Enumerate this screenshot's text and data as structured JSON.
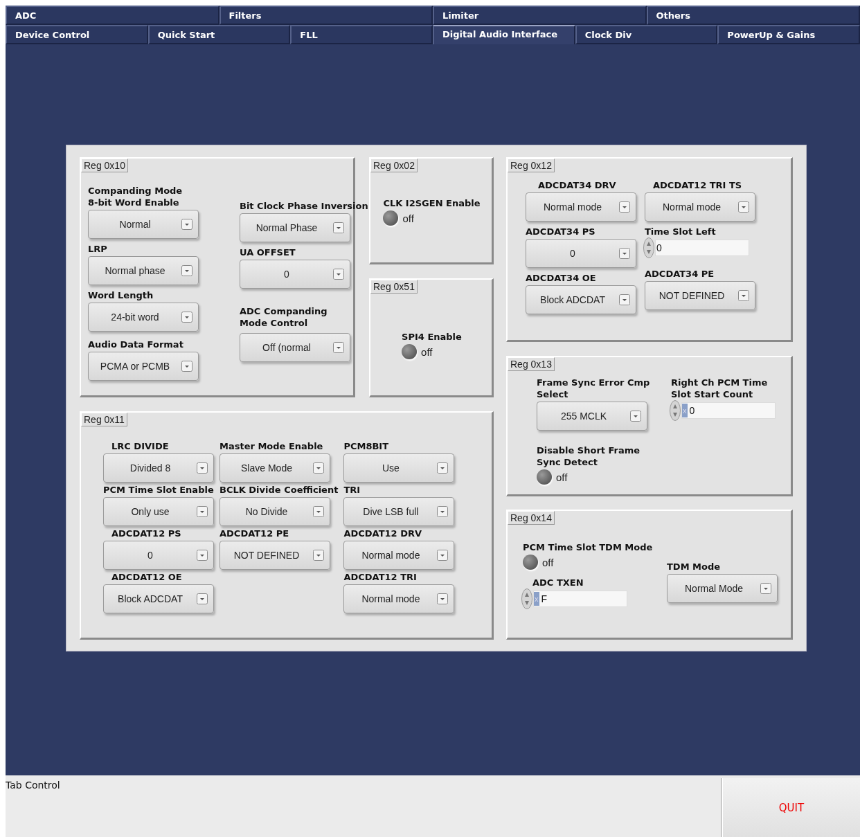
{
  "tab_rows": [
    [
      {
        "label": "ADC",
        "selected": false
      },
      {
        "label": "Filters",
        "selected": false
      },
      {
        "label": "Limiter",
        "selected": false
      },
      {
        "label": "Others",
        "selected": false
      }
    ],
    [
      {
        "label": "Device Control",
        "selected": false
      },
      {
        "label": "Quick Start",
        "selected": false
      },
      {
        "label": "FLL",
        "selected": false
      },
      {
        "label": "Digital Audio Interface",
        "selected": true
      },
      {
        "label": "Clock Div",
        "selected": false
      },
      {
        "label": "PowerUp & Gains",
        "selected": false
      }
    ]
  ],
  "panels": [
    {
      "title": "Reg 0x10",
      "columns": [
        [
          {
            "kind": "dropdown",
            "label": "Companding Mode 8-bit Word Enable",
            "value": "Normal"
          },
          {
            "kind": "dropdown",
            "label": "LRP",
            "value": "Normal phase"
          },
          {
            "kind": "dropdown",
            "label": "Word Length",
            "value": "24-bit word"
          },
          {
            "kind": "dropdown",
            "label": "Audio Data Format",
            "value": "PCMA or PCMB"
          }
        ],
        [
          {
            "kind": "dropdown",
            "label": "Bit Clock Phase Inversion",
            "value": "Normal Phase"
          },
          {
            "kind": "dropdown",
            "label": "UA OFFSET",
            "value": "0"
          },
          {
            "kind": "dropdown",
            "label": "ADC Companding Mode Control",
            "value": "Off (normal"
          }
        ]
      ]
    },
    {
      "title": "Reg 0x02",
      "columns": [
        [
          {
            "kind": "led",
            "label": "CLK I2SGEN Enable",
            "on": false,
            "state_text": "off"
          }
        ]
      ]
    },
    {
      "title": "Reg 0x12",
      "columns": [
        [
          {
            "kind": "dropdown",
            "label": "ADCDAT34 DRV",
            "value": "Normal mode"
          },
          {
            "kind": "dropdown",
            "label": "ADCDAT34 PS",
            "value": "0"
          },
          {
            "kind": "dropdown",
            "label": "ADCDAT34 OE",
            "value": "Block ADCDAT"
          }
        ],
        [
          {
            "kind": "dropdown",
            "label": "ADCDAT12 TRI TS",
            "value": "Normal mode"
          },
          {
            "kind": "numeric",
            "label": "Time Slot Left",
            "value": "0"
          },
          {
            "kind": "dropdown",
            "label": "ADCDAT34 PE",
            "value": "NOT DEFINED"
          }
        ]
      ]
    },
    {
      "title": "Reg 0x51",
      "columns": [
        [
          {
            "kind": "led",
            "label": "SPI4 Enable",
            "on": false,
            "state_text": "off"
          }
        ]
      ]
    },
    {
      "title": "Reg 0x11",
      "columns": [
        [
          {
            "kind": "dropdown",
            "label": "LRC DIVIDE",
            "value": "Divided 8"
          },
          {
            "kind": "dropdown",
            "label": "PCM Time Slot Enable",
            "value": "Only use"
          },
          {
            "kind": "dropdown",
            "label": "ADCDAT12 PS",
            "value": "0"
          },
          {
            "kind": "dropdown",
            "label": "ADCDAT12 OE",
            "value": "Block ADCDAT"
          }
        ],
        [
          {
            "kind": "dropdown",
            "label": "Master Mode Enable",
            "value": "Slave Mode"
          },
          {
            "kind": "dropdown",
            "label": "BCLK Divide Coefficient",
            "value": "No Divide"
          },
          {
            "kind": "dropdown",
            "label": "ADCDAT12 PE",
            "value": "NOT DEFINED"
          }
        ],
        [
          {
            "kind": "dropdown",
            "label": "PCM8BIT",
            "value": "Use"
          },
          {
            "kind": "dropdown",
            "label": "TRI",
            "value": "Dive LSB full"
          },
          {
            "kind": "dropdown",
            "label": "ADCDAT12 DRV",
            "value": "Normal mode"
          },
          {
            "kind": "dropdown",
            "label": "ADCDAT12 TRI",
            "value": "Normal mode"
          }
        ]
      ]
    },
    {
      "title": "Reg 0x13",
      "columns": [
        [
          {
            "kind": "dropdown",
            "label": "Frame Sync Error Cmp Select",
            "value": "255 MCLK"
          },
          {
            "kind": "led",
            "label": "Disable Short Frame Sync Detect",
            "on": false,
            "state_text": "off"
          }
        ],
        [
          {
            "kind": "numeric",
            "label": "Right Ch PCM Time Slot Start Count",
            "radix": "x",
            "value": "0"
          }
        ]
      ]
    },
    {
      "title": "Reg 0x14",
      "columns": [
        [
          {
            "kind": "led",
            "label": "PCM Time Slot TDM Mode",
            "on": false,
            "state_text": "off"
          },
          {
            "kind": "numeric",
            "label": "ADC TXEN",
            "radix": "x",
            "value": "F"
          }
        ],
        [
          {
            "kind": "dropdown",
            "label": "TDM Mode",
            "value": "Normal Mode"
          }
        ]
      ]
    }
  ],
  "status_bar": {
    "label": "Tab Control"
  },
  "quit_button": "QUIT"
}
